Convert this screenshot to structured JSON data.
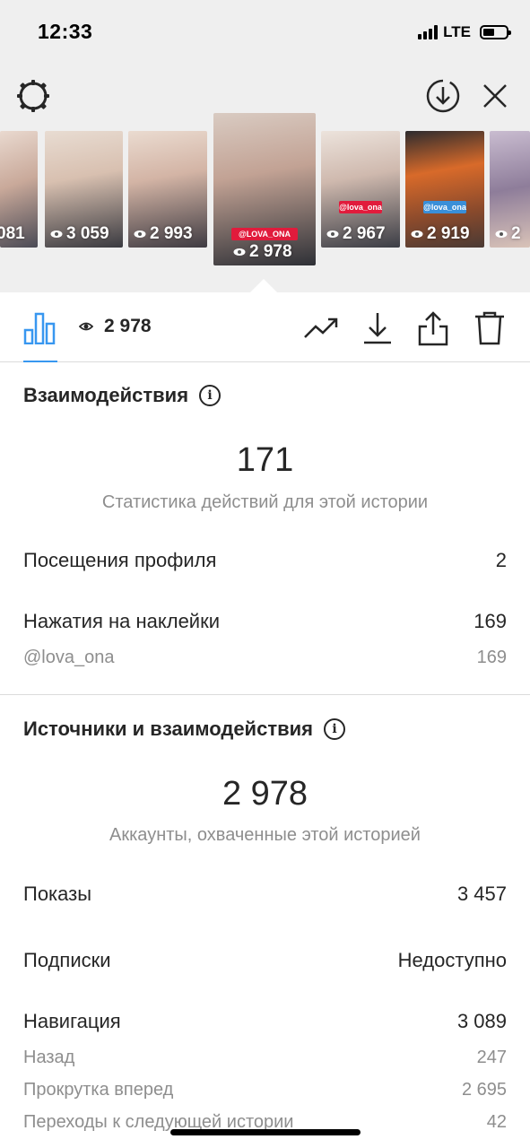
{
  "status_bar": {
    "time": "12:33",
    "network": "LTE"
  },
  "stories": [
    {
      "views": "081",
      "caption": ""
    },
    {
      "views": "3 059",
      "caption": ""
    },
    {
      "views": "2 993",
      "caption": ""
    },
    {
      "views": "2 978",
      "tag": "@LOVA_ONA",
      "selected": true
    },
    {
      "views": "2 967",
      "tag": "@lova_ona"
    },
    {
      "views": "2 919",
      "tag": "@lova_ona"
    },
    {
      "views": "2",
      "caption": ""
    }
  ],
  "toolbar": {
    "views": "2 978"
  },
  "interactions": {
    "title": "Взаимодействия",
    "total": "171",
    "total_label": "Статистика действий для этой истории",
    "rows": [
      {
        "label": "Посещения профиля",
        "value": "2"
      },
      {
        "label": "Нажатия на наклейки",
        "value": "169"
      }
    ],
    "sticker_row": {
      "label": "@lova_ona",
      "value": "169"
    }
  },
  "discovery": {
    "title": "Источники и взаимодействия",
    "total": "2 978",
    "total_label": "Аккаунты, охваченные этой историей",
    "impressions": {
      "label": "Показы",
      "value": "3 457"
    },
    "follows": {
      "label": "Подписки",
      "value": "Недоступно"
    },
    "navigation": {
      "label": "Навигация",
      "value": "3 089"
    },
    "nav_rows": [
      {
        "label": "Назад",
        "value": "247"
      },
      {
        "label": "Прокрутка вперед",
        "value": "2 695"
      },
      {
        "label": "Переходы к следующей истории",
        "value": "42"
      }
    ]
  },
  "colors": {
    "accent": "#3897f0",
    "muted": "#8e8e8e",
    "text": "#262626",
    "header_bg": "#efefef"
  },
  "icons": [
    "gear-icon",
    "download-circle-icon",
    "close-icon",
    "bar-chart-icon",
    "eye-icon",
    "trending-icon",
    "download-icon",
    "share-icon",
    "trash-icon",
    "info-icon"
  ]
}
